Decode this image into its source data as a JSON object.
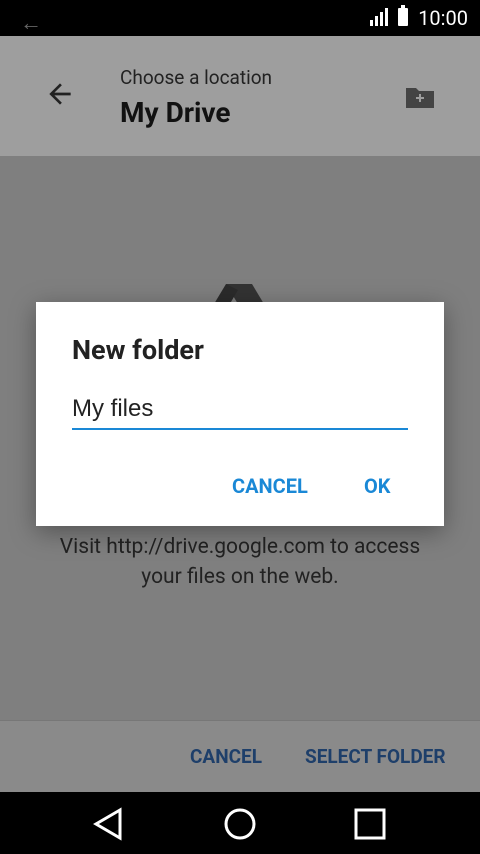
{
  "status_bar": {
    "time": "10:00"
  },
  "header": {
    "subtitle": "Choose a location",
    "title": "My Drive"
  },
  "content": {
    "info_line1": "Visit http://drive.google.com to access",
    "info_line2": "your files on the web."
  },
  "bottom_actions": {
    "cancel_label": "CANCEL",
    "select_label": "SELECT FOLDER"
  },
  "dialog": {
    "title": "New folder",
    "input_value": "My files",
    "cancel_label": "CANCEL",
    "ok_label": "OK",
    "accent_color": "#1a88d6"
  },
  "icons": [
    "back-arrow-icon",
    "new-folder-icon",
    "drive-logo-icon",
    "nav-back-icon",
    "nav-home-icon",
    "nav-recent-icon"
  ]
}
